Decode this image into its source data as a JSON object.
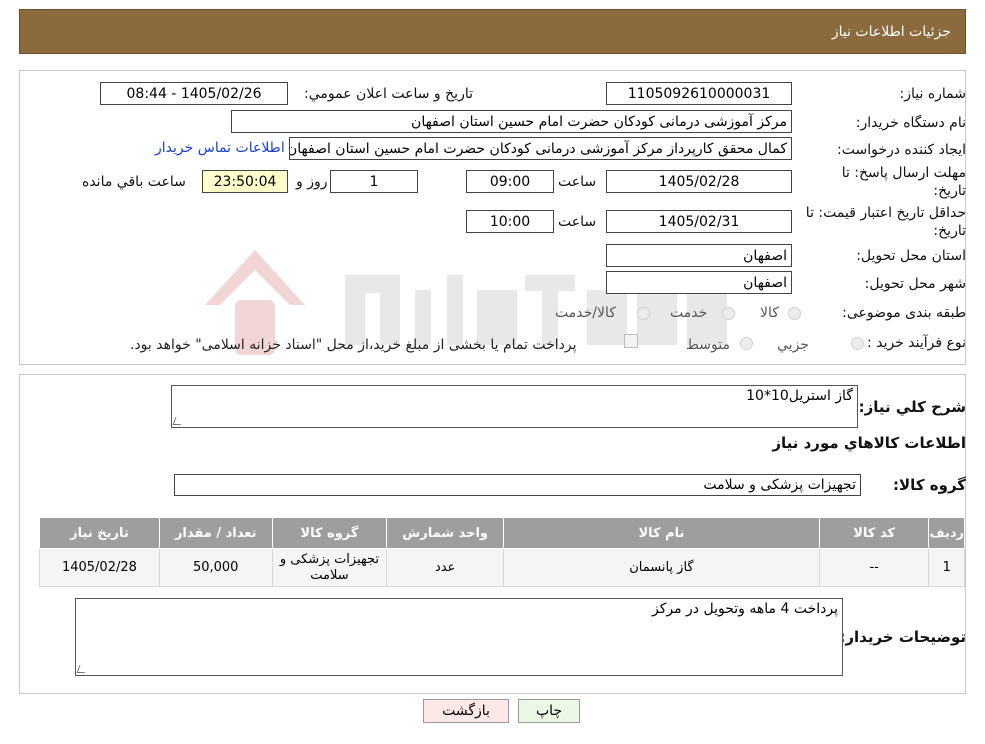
{
  "header": {
    "title": "جزئیات اطلاعات نیاز"
  },
  "form": {
    "need_number_label": "شماره نیاز:",
    "need_number": "1105092610000031",
    "announce_label": "تاریخ و ساعت اعلان عمومي:",
    "announce_value": "1405/02/26 - 08:44",
    "buyer_org_label": "نام دستگاه خریدار:",
    "buyer_org": "مرکز آموزشی درمانی کودکان حضرت امام حسین استان اصفهان",
    "creator_label": "ایجاد کننده درخواست:",
    "creator": "کمال محقق کارپرداز مرکز آموزشی درمانی کودکان حضرت امام حسین استان اصفهان",
    "contact_link": "اطلاعات تماس خریدار",
    "deadline_label_1": "مهلت ارسال پاسخ: تا",
    "deadline_label_2": "تاریخ:",
    "deadline_date": "1405/02/28",
    "time_label": "ساعت",
    "deadline_time": "09:00",
    "days_value": "1",
    "days_label": "روز و",
    "remaining_time": "23:50:04",
    "remaining_label": "ساعت باقي مانده",
    "validity_label_1": "حداقل تاریخ اعتبار قیمت: تا",
    "validity_label_2": "تاریخ:",
    "validity_date": "1405/02/31",
    "validity_time": "10:00",
    "province_label": "استان محل تحویل:",
    "province": "اصفهان",
    "city_label": "شهر محل تحویل:",
    "city": "اصفهان",
    "category_label": "طبقه بندی موضوعی:",
    "category_options": [
      "کالا",
      "خدمت",
      "کالا/خدمت"
    ],
    "process_label": "نوع فرآیند خرید :",
    "process_options": [
      "جزیي",
      "متوسط"
    ],
    "process_note": "پرداخت تمام یا بخشی از مبلغ خرید،از محل \"اسناد خزانه اسلامی\" خواهد بود."
  },
  "summary": {
    "description_label": "شرح كلي نياز:",
    "description": "گاز استریل10*10",
    "items_title": "اطلاعات كالاهاي مورد نياز",
    "group_label": "گروه کالا:",
    "group_value": "تجهیزات پزشکی و سلامت"
  },
  "table": {
    "headers": [
      "رديف",
      "كد كالا",
      "نام كالا",
      "واحد شمارش",
      "گروه كالا",
      "تعداد / مقدار",
      "تاريخ نياز"
    ],
    "rows": [
      [
        "1",
        "--",
        "گاز پانسمان",
        "عدد",
        "تجهیزات پزشکی و سلامت",
        "50,000",
        "1405/02/28"
      ]
    ]
  },
  "notes": {
    "label": "توضیحات خریدار:",
    "text": "پرداخت 4 ماهه وتحویل در مرکز"
  },
  "buttons": {
    "back": "بازگشت",
    "print": "چاپ"
  },
  "colors": {
    "header_bg": "#8b6a3e",
    "table_header_bg": "#9e9e9e",
    "back_button_bg": "#fde7e7",
    "print_button_bg": "#eaf7e4",
    "remaining_bg": "#ffffcc"
  }
}
